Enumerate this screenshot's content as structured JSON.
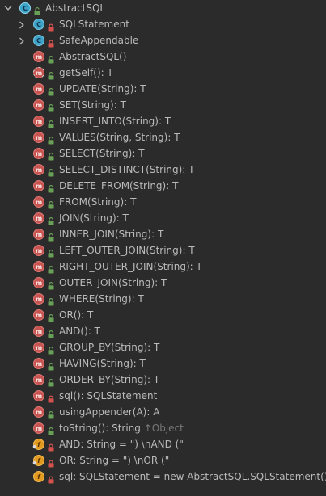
{
  "root": {
    "label": "AbstractSQL",
    "expanded": true
  },
  "items": [
    {
      "kind": "class",
      "access": "private",
      "label": "SQLStatement",
      "expandable": true
    },
    {
      "kind": "class",
      "access": "private",
      "label": "SafeAppendable",
      "expandable": true
    },
    {
      "kind": "method",
      "access": "public",
      "label": "AbstractSQL()"
    },
    {
      "kind": "abstract-method",
      "access": "public",
      "label": "getSelf(): T"
    },
    {
      "kind": "method",
      "access": "public",
      "label": "UPDATE(String): T"
    },
    {
      "kind": "method",
      "access": "public",
      "label": "SET(String): T"
    },
    {
      "kind": "method",
      "access": "public",
      "label": "INSERT_INTO(String): T"
    },
    {
      "kind": "method",
      "access": "public",
      "label": "VALUES(String, String): T"
    },
    {
      "kind": "method",
      "access": "public",
      "label": "SELECT(String): T"
    },
    {
      "kind": "method",
      "access": "public",
      "label": "SELECT_DISTINCT(String): T"
    },
    {
      "kind": "method",
      "access": "public",
      "label": "DELETE_FROM(String): T"
    },
    {
      "kind": "method",
      "access": "public",
      "label": "FROM(String): T"
    },
    {
      "kind": "method",
      "access": "public",
      "label": "JOIN(String): T"
    },
    {
      "kind": "method",
      "access": "public",
      "label": "INNER_JOIN(String): T"
    },
    {
      "kind": "method",
      "access": "public",
      "label": "LEFT_OUTER_JOIN(String): T"
    },
    {
      "kind": "method",
      "access": "public",
      "label": "RIGHT_OUTER_JOIN(String): T"
    },
    {
      "kind": "method",
      "access": "public",
      "label": "OUTER_JOIN(String): T"
    },
    {
      "kind": "method",
      "access": "public",
      "label": "WHERE(String): T"
    },
    {
      "kind": "method",
      "access": "public",
      "label": "OR(): T"
    },
    {
      "kind": "method",
      "access": "public",
      "label": "AND(): T"
    },
    {
      "kind": "method",
      "access": "public",
      "label": "GROUP_BY(String): T"
    },
    {
      "kind": "method",
      "access": "public",
      "label": "HAVING(String): T"
    },
    {
      "kind": "method",
      "access": "public",
      "label": "ORDER_BY(String): T"
    },
    {
      "kind": "method",
      "access": "private",
      "label": "sql(): SQLStatement"
    },
    {
      "kind": "method",
      "access": "public",
      "label": "usingAppender(A): A"
    },
    {
      "kind": "method",
      "access": "public",
      "label": "toString(): String",
      "inherited": "↑Object"
    },
    {
      "kind": "field",
      "access": "private",
      "static": true,
      "label": "AND: String = \") \\nAND (\""
    },
    {
      "kind": "field",
      "access": "private",
      "static": true,
      "label": "OR: String = \") \\nOR (\""
    },
    {
      "kind": "field",
      "access": "private",
      "label": "sql: SQLStatement = new AbstractSQL.SQLStatement()"
    }
  ],
  "colors": {
    "background": "#2b2b2b",
    "text": "#bbbbbb",
    "inherited_text": "#787878",
    "class_icon": "#3fa3c8",
    "method_icon": "#c75450",
    "field_icon": "#e29a20",
    "public_access": "#68a057",
    "private_access": "#d3524e"
  },
  "icons": {
    "class": "class-icon",
    "method": "method-icon",
    "field": "field-icon",
    "public": "unlocked-public-icon",
    "private": "lock-private-icon",
    "expand": "chevron-right-icon",
    "collapse": "chevron-down-icon"
  }
}
